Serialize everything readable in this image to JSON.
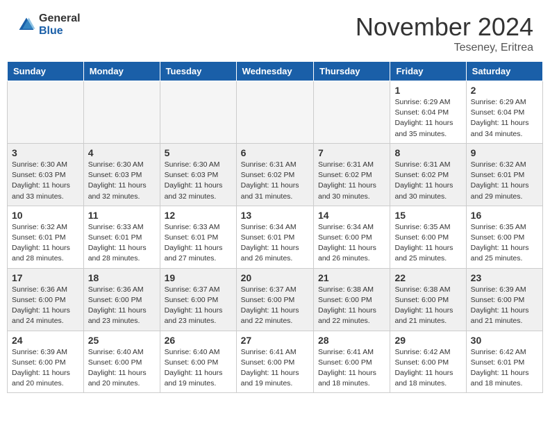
{
  "header": {
    "logo_general": "General",
    "logo_blue": "Blue",
    "month_title": "November 2024",
    "location": "Teseney, Eritrea"
  },
  "days_of_week": [
    "Sunday",
    "Monday",
    "Tuesday",
    "Wednesday",
    "Thursday",
    "Friday",
    "Saturday"
  ],
  "weeks": [
    [
      {
        "day": "",
        "info": "",
        "empty": true
      },
      {
        "day": "",
        "info": "",
        "empty": true
      },
      {
        "day": "",
        "info": "",
        "empty": true
      },
      {
        "day": "",
        "info": "",
        "empty": true
      },
      {
        "day": "",
        "info": "",
        "empty": true
      },
      {
        "day": "1",
        "info": "Sunrise: 6:29 AM\nSunset: 6:04 PM\nDaylight: 11 hours\nand 35 minutes."
      },
      {
        "day": "2",
        "info": "Sunrise: 6:29 AM\nSunset: 6:04 PM\nDaylight: 11 hours\nand 34 minutes."
      }
    ],
    [
      {
        "day": "3",
        "info": "Sunrise: 6:30 AM\nSunset: 6:03 PM\nDaylight: 11 hours\nand 33 minutes."
      },
      {
        "day": "4",
        "info": "Sunrise: 6:30 AM\nSunset: 6:03 PM\nDaylight: 11 hours\nand 32 minutes."
      },
      {
        "day": "5",
        "info": "Sunrise: 6:30 AM\nSunset: 6:03 PM\nDaylight: 11 hours\nand 32 minutes."
      },
      {
        "day": "6",
        "info": "Sunrise: 6:31 AM\nSunset: 6:02 PM\nDaylight: 11 hours\nand 31 minutes."
      },
      {
        "day": "7",
        "info": "Sunrise: 6:31 AM\nSunset: 6:02 PM\nDaylight: 11 hours\nand 30 minutes."
      },
      {
        "day": "8",
        "info": "Sunrise: 6:31 AM\nSunset: 6:02 PM\nDaylight: 11 hours\nand 30 minutes."
      },
      {
        "day": "9",
        "info": "Sunrise: 6:32 AM\nSunset: 6:01 PM\nDaylight: 11 hours\nand 29 minutes."
      }
    ],
    [
      {
        "day": "10",
        "info": "Sunrise: 6:32 AM\nSunset: 6:01 PM\nDaylight: 11 hours\nand 28 minutes."
      },
      {
        "day": "11",
        "info": "Sunrise: 6:33 AM\nSunset: 6:01 PM\nDaylight: 11 hours\nand 28 minutes."
      },
      {
        "day": "12",
        "info": "Sunrise: 6:33 AM\nSunset: 6:01 PM\nDaylight: 11 hours\nand 27 minutes."
      },
      {
        "day": "13",
        "info": "Sunrise: 6:34 AM\nSunset: 6:01 PM\nDaylight: 11 hours\nand 26 minutes."
      },
      {
        "day": "14",
        "info": "Sunrise: 6:34 AM\nSunset: 6:00 PM\nDaylight: 11 hours\nand 26 minutes."
      },
      {
        "day": "15",
        "info": "Sunrise: 6:35 AM\nSunset: 6:00 PM\nDaylight: 11 hours\nand 25 minutes."
      },
      {
        "day": "16",
        "info": "Sunrise: 6:35 AM\nSunset: 6:00 PM\nDaylight: 11 hours\nand 25 minutes."
      }
    ],
    [
      {
        "day": "17",
        "info": "Sunrise: 6:36 AM\nSunset: 6:00 PM\nDaylight: 11 hours\nand 24 minutes."
      },
      {
        "day": "18",
        "info": "Sunrise: 6:36 AM\nSunset: 6:00 PM\nDaylight: 11 hours\nand 23 minutes."
      },
      {
        "day": "19",
        "info": "Sunrise: 6:37 AM\nSunset: 6:00 PM\nDaylight: 11 hours\nand 23 minutes."
      },
      {
        "day": "20",
        "info": "Sunrise: 6:37 AM\nSunset: 6:00 PM\nDaylight: 11 hours\nand 22 minutes."
      },
      {
        "day": "21",
        "info": "Sunrise: 6:38 AM\nSunset: 6:00 PM\nDaylight: 11 hours\nand 22 minutes."
      },
      {
        "day": "22",
        "info": "Sunrise: 6:38 AM\nSunset: 6:00 PM\nDaylight: 11 hours\nand 21 minutes."
      },
      {
        "day": "23",
        "info": "Sunrise: 6:39 AM\nSunset: 6:00 PM\nDaylight: 11 hours\nand 21 minutes."
      }
    ],
    [
      {
        "day": "24",
        "info": "Sunrise: 6:39 AM\nSunset: 6:00 PM\nDaylight: 11 hours\nand 20 minutes."
      },
      {
        "day": "25",
        "info": "Sunrise: 6:40 AM\nSunset: 6:00 PM\nDaylight: 11 hours\nand 20 minutes."
      },
      {
        "day": "26",
        "info": "Sunrise: 6:40 AM\nSunset: 6:00 PM\nDaylight: 11 hours\nand 19 minutes."
      },
      {
        "day": "27",
        "info": "Sunrise: 6:41 AM\nSunset: 6:00 PM\nDaylight: 11 hours\nand 19 minutes."
      },
      {
        "day": "28",
        "info": "Sunrise: 6:41 AM\nSunset: 6:00 PM\nDaylight: 11 hours\nand 18 minutes."
      },
      {
        "day": "29",
        "info": "Sunrise: 6:42 AM\nSunset: 6:00 PM\nDaylight: 11 hours\nand 18 minutes."
      },
      {
        "day": "30",
        "info": "Sunrise: 6:42 AM\nSunset: 6:01 PM\nDaylight: 11 hours\nand 18 minutes."
      }
    ]
  ]
}
